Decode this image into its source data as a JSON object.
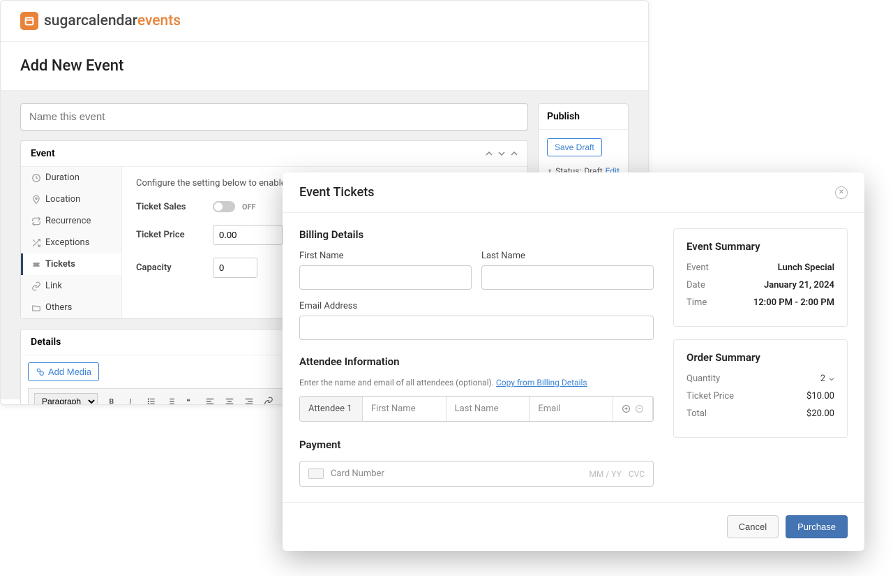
{
  "logo": {
    "black": "sugarcalendar",
    "orange": "events"
  },
  "pageTitle": "Add New Event",
  "nameInput": {
    "placeholder": "Name this event"
  },
  "eventBox": {
    "title": "Event",
    "sidebar": [
      {
        "label": "Duration"
      },
      {
        "label": "Location"
      },
      {
        "label": "Recurrence"
      },
      {
        "label": "Exceptions"
      },
      {
        "label": "Tickets"
      },
      {
        "label": "Link"
      },
      {
        "label": "Others"
      }
    ],
    "desc": "Configure the setting below to enable and",
    "ticketSalesLabel": "Ticket Sales",
    "ticketSalesState": "OFF",
    "ticketPriceLabel": "Ticket Price",
    "ticketPriceValue": "0.00",
    "capacityLabel": "Capacity",
    "capacityValue": "0"
  },
  "detailsBox": {
    "title": "Details",
    "addMedia": "Add Media",
    "paragraph": "Paragraph"
  },
  "publishBox": {
    "title": "Publish",
    "saveDraft": "Save Draft",
    "statusLabel": "Status:",
    "statusValue": "Draft",
    "editLabel": "Edit"
  },
  "modal": {
    "title": "Event Tickets",
    "billing": {
      "title": "Billing Details",
      "firstName": "First Name",
      "lastName": "Last Name",
      "email": "Email Address"
    },
    "attendee": {
      "title": "Attendee Information",
      "subtext": "Enter the name and email of all attendees (optional).",
      "copyLink": "Copy from Billing Details",
      "rowLabel": "Attendee 1",
      "firstPh": "First Name",
      "lastPh": "Last Name",
      "emailPh": "Email"
    },
    "payment": {
      "title": "Payment",
      "cardPh": "Card Number",
      "mmYY": "MM / YY",
      "cvc": "CVC"
    },
    "eventSummary": {
      "title": "Event Summary",
      "rows": [
        {
          "label": "Event",
          "value": "Lunch Special"
        },
        {
          "label": "Date",
          "value": "January 21, 2024"
        },
        {
          "label": "Time",
          "value": "12:00 PM - 2:00 PM"
        }
      ]
    },
    "orderSummary": {
      "title": "Order Summary",
      "qtyLabel": "Quantity",
      "qtyValue": "2",
      "priceLabel": "Ticket Price",
      "priceValue": "$10.00",
      "totalLabel": "Total",
      "totalValue": "$20.00"
    },
    "cancel": "Cancel",
    "purchase": "Purchase"
  }
}
